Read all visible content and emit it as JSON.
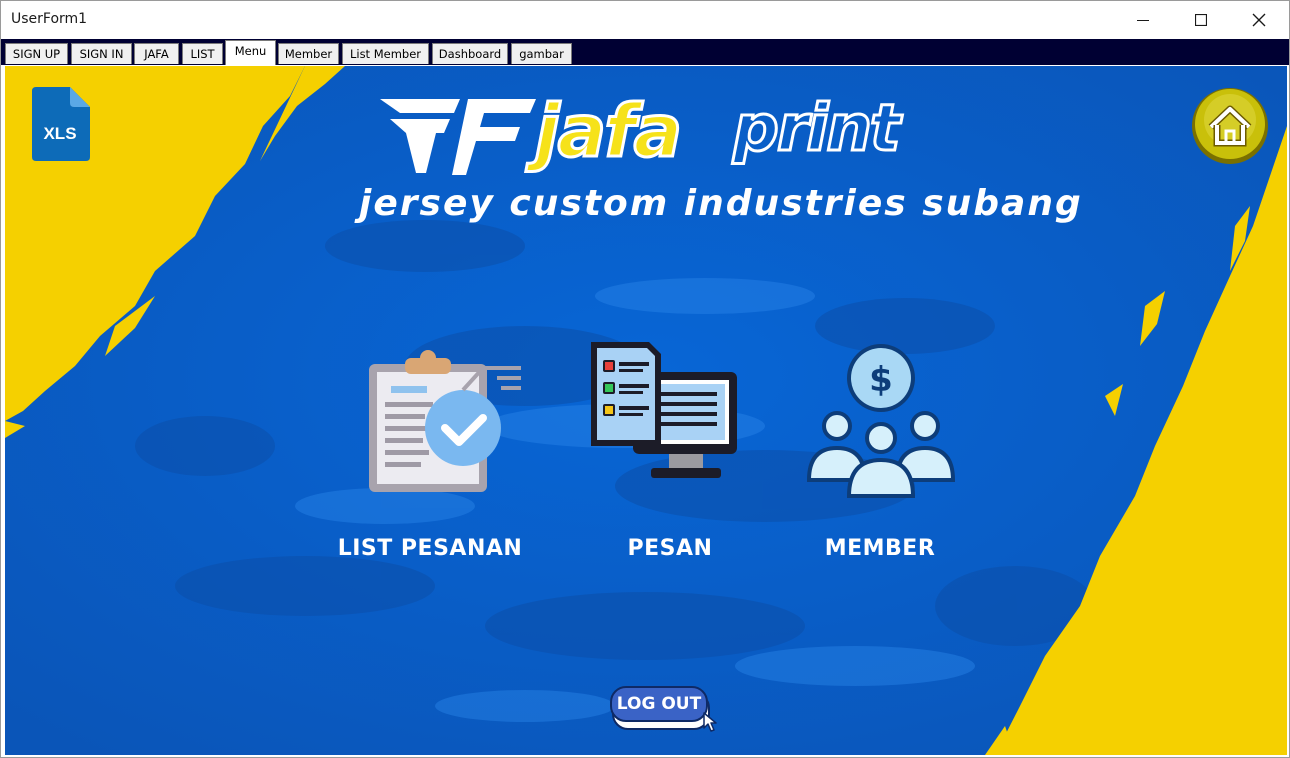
{
  "window": {
    "title": "UserForm1",
    "controls": [
      "minimize",
      "maximize",
      "close"
    ]
  },
  "tabs": [
    {
      "label": "SIGN UP",
      "active": false
    },
    {
      "label": "SIGN IN",
      "active": false
    },
    {
      "label": "JAFA",
      "active": false
    },
    {
      "label": "LIST",
      "active": false
    },
    {
      "label": "Menu",
      "active": true
    },
    {
      "label": "Member",
      "active": false
    },
    {
      "label": "List Member",
      "active": false
    },
    {
      "label": "Dashboard",
      "active": false
    },
    {
      "label": "gambar",
      "active": false
    }
  ],
  "header": {
    "xls_badge": "XLS",
    "logo_word_1": "jafa",
    "logo_word_2": "print",
    "tagline": "jersey custom industries subang",
    "home_icon": "home-icon"
  },
  "menu": [
    {
      "label": "LIST PESANAN",
      "icon": "clipboard-check-icon"
    },
    {
      "label": "PESAN",
      "icon": "computer-order-form-icon"
    },
    {
      "label": "MEMBER",
      "icon": "members-dollar-icon"
    }
  ],
  "logout": {
    "label": "LOG OUT"
  },
  "colors": {
    "background_blue": "#0a5fc8",
    "accent_yellow": "#f5d000",
    "tab_strip": "#000033",
    "logout_button": "#3a63c6",
    "home_button": "#c9c00a"
  }
}
